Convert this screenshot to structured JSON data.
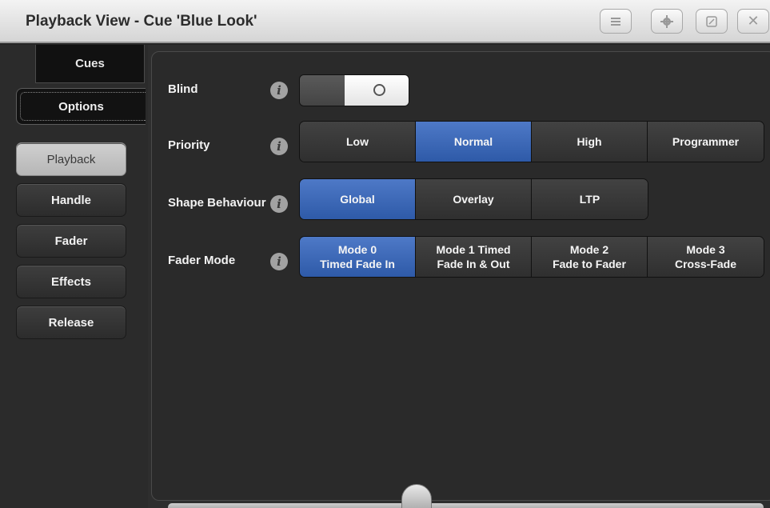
{
  "window": {
    "title": "Playback View - Cue 'Blue Look'"
  },
  "titlebar_buttons": [
    {
      "icon": "menu-icon"
    },
    {
      "icon": "gear-icon"
    },
    {
      "icon": "maximize-icon"
    },
    {
      "icon": "close-icon",
      "glyph": "✕"
    }
  ],
  "tabs": {
    "cues": "Cues",
    "options": "Options"
  },
  "sidebar": {
    "items": [
      {
        "label": "Playback",
        "active": true
      },
      {
        "label": "Handle"
      },
      {
        "label": "Fader"
      },
      {
        "label": "Effects"
      },
      {
        "label": "Release"
      }
    ]
  },
  "options": {
    "blind": {
      "label": "Blind",
      "state": "off"
    },
    "priority": {
      "label": "Priority",
      "options": [
        "Low",
        "Normal",
        "High",
        "Programmer"
      ],
      "selected": "Normal"
    },
    "shape_behaviour": {
      "label": "Shape Behaviour",
      "options": [
        "Global",
        "Overlay",
        "LTP"
      ],
      "selected": "Global"
    },
    "fader_mode": {
      "label": "Fader Mode",
      "options": [
        {
          "line1": "Mode 0",
          "line2": "Timed Fade In"
        },
        {
          "line1": "Mode 1 Timed",
          "line2": "Fade In & Out"
        },
        {
          "line1": "Mode 2",
          "line2": "Fade to Fader"
        },
        {
          "line1": "Mode 3",
          "line2": "Cross-Fade"
        }
      ],
      "selected_index": 0
    }
  },
  "info_glyph": "i",
  "colors": {
    "selected": "#3a66b8",
    "background": "#2a2a2a",
    "titlebar": "#e4e4e4"
  }
}
